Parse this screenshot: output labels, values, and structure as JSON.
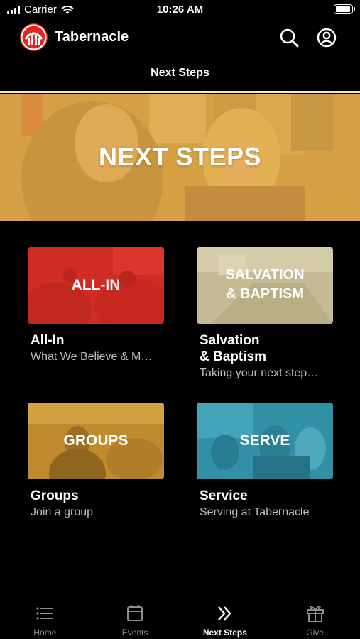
{
  "status_bar": {
    "carrier": "Carrier",
    "time": "10:26 AM",
    "battery_level": 1.0
  },
  "header": {
    "app_name": "Tabernacle",
    "page_title": "Next Steps",
    "brand_color": "#e3261f"
  },
  "hero": {
    "title": "NEXT STEPS"
  },
  "cards": [
    {
      "thumb_text": "ALL-IN",
      "title": "All-In",
      "subtitle": "What We Believe & M…",
      "tint": "#e0332a"
    },
    {
      "thumb_text_line1": "SALVATION",
      "thumb_text_line2": "& BAPTISM",
      "title_line1": "Salvation",
      "title_line2": "& Baptism",
      "subtitle": "Taking your next step…",
      "tint": "#cfc6a0"
    },
    {
      "thumb_text": "GROUPS",
      "title": "Groups",
      "subtitle": "Join a group",
      "tint": "#c8942e"
    },
    {
      "thumb_text": "SERVE",
      "title": "Service",
      "subtitle": "Serving at Tabernacle",
      "tint": "#3a9ab0"
    }
  ],
  "tabs": [
    {
      "label": "Home",
      "icon": "list-icon"
    },
    {
      "label": "Events",
      "icon": "calendar-icon"
    },
    {
      "label": "Next Steps",
      "icon": "double-chevron-icon",
      "active": true
    },
    {
      "label": "Give",
      "icon": "gift-icon"
    }
  ]
}
